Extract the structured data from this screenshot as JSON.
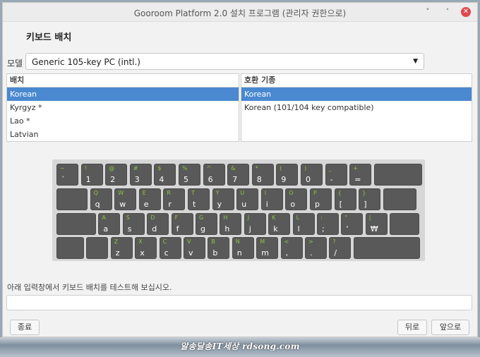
{
  "window": {
    "title": "Gooroom Platform 2.0 설치 프로그램 (관리자 권한으로)",
    "minimize_glyph": "˅",
    "maximize_glyph": "˄",
    "close_glyph": "✕"
  },
  "page": {
    "heading": "키보드 배치"
  },
  "model": {
    "label": "모델",
    "value": "Generic 105-key PC (intl.)",
    "arrow": "▼"
  },
  "layout_list": {
    "header": "배치",
    "items": [
      "Korean",
      "Kyrgyz *",
      "Lao *",
      "Latvian"
    ],
    "selected": "Korean"
  },
  "variant_list": {
    "header": "호환 기종",
    "items": [
      "Korean",
      "Korean (101/104 key compatible)"
    ],
    "selected": "Korean"
  },
  "keyboard": {
    "rows": [
      [
        [
          "~",
          "`"
        ],
        [
          "!",
          "1"
        ],
        [
          "@",
          "2"
        ],
        [
          "#",
          "3"
        ],
        [
          "$",
          "4"
        ],
        [
          "%",
          "5"
        ],
        [
          "^",
          "6"
        ],
        [
          "&",
          "7"
        ],
        [
          "*",
          "8"
        ],
        [
          "(",
          "9"
        ],
        [
          ")",
          "0"
        ],
        [
          "_",
          "-"
        ],
        [
          "+",
          "="
        ],
        [
          "",
          ""
        ]
      ],
      [
        [
          "",
          ""
        ],
        [
          "Q",
          "q"
        ],
        [
          "W",
          "w"
        ],
        [
          "E",
          "e"
        ],
        [
          "R",
          "r"
        ],
        [
          "T",
          "t"
        ],
        [
          "Y",
          "y"
        ],
        [
          "U",
          "u"
        ],
        [
          "I",
          "i"
        ],
        [
          "O",
          "o"
        ],
        [
          "P",
          "p"
        ],
        [
          "{",
          "["
        ],
        [
          "}",
          "]"
        ],
        [
          "",
          ""
        ]
      ],
      [
        [
          "",
          ""
        ],
        [
          "A",
          "a"
        ],
        [
          "S",
          "s"
        ],
        [
          "D",
          "d"
        ],
        [
          "F",
          "f"
        ],
        [
          "G",
          "g"
        ],
        [
          "H",
          "h"
        ],
        [
          "J",
          "j"
        ],
        [
          "K",
          "k"
        ],
        [
          "L",
          "l"
        ],
        [
          ":",
          ";"
        ],
        [
          "\"",
          "'"
        ],
        [
          "|",
          "₩"
        ],
        [
          "",
          ""
        ]
      ],
      [
        [
          "",
          ""
        ],
        [
          "",
          ""
        ],
        [
          "Z",
          "z"
        ],
        [
          "X",
          "x"
        ],
        [
          "C",
          "c"
        ],
        [
          "V",
          "v"
        ],
        [
          "B",
          "b"
        ],
        [
          "N",
          "n"
        ],
        [
          "M",
          "m"
        ],
        [
          "<",
          ","
        ],
        [
          ">",
          "."
        ],
        [
          "?",
          "/"
        ],
        [
          "",
          ""
        ]
      ]
    ]
  },
  "test": {
    "prompt": "아래 입력창에서 키보드 배치를 테스트해 보십시오.",
    "value": ""
  },
  "buttons": {
    "quit": "종료",
    "back": "뒤로",
    "next": "앞으로"
  },
  "watermark": "알송달송IT세상 rdsong.com"
}
